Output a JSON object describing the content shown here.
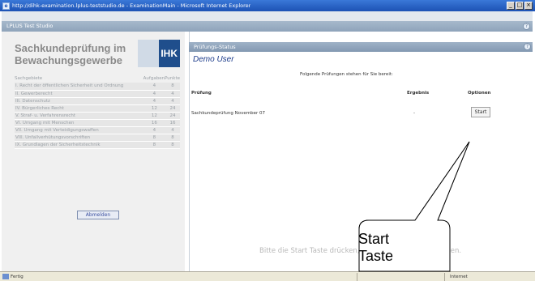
{
  "window": {
    "title": "http://dihk-examination.lplus-teststudio.de - ExaminationMain - Microsoft Internet Explorer",
    "minimize": "_",
    "maximize": "□",
    "close": "×"
  },
  "app": {
    "name": "LPLUS Test Studio",
    "help": "?"
  },
  "left": {
    "title": "Sachkundeprüfung im Bewachungsgewerbe",
    "logo_text": "IHK",
    "table_headers": {
      "subject": "Sachgebiete",
      "tasks": "Aufgaben",
      "points": "Punkte"
    },
    "subjects": [
      {
        "name": "I. Recht der öffentlichen Sicherheit und Ordnung",
        "tasks": "4",
        "points": "8"
      },
      {
        "name": "II. Gewerberecht",
        "tasks": "4",
        "points": "4"
      },
      {
        "name": "III. Datenschutz",
        "tasks": "4",
        "points": "4"
      },
      {
        "name": "IV. Bürgerliches Recht",
        "tasks": "12",
        "points": "24"
      },
      {
        "name": "V. Straf- u. Verfahrensrecht",
        "tasks": "12",
        "points": "24"
      },
      {
        "name": "VI. Umgang mit Menschen",
        "tasks": "16",
        "points": "16"
      },
      {
        "name": "VII. Umgang mit Verteidigungswaffen",
        "tasks": "4",
        "points": "4"
      },
      {
        "name": "VIII. Unfallverhütungsvorschriften",
        "tasks": "8",
        "points": "8"
      },
      {
        "name": "IX. Grundlagen der Sicherheitstechnik",
        "tasks": "8",
        "points": "8"
      }
    ],
    "logout_label": "Abmelden"
  },
  "right": {
    "header": "Prüfungs-Status",
    "help": "?",
    "user": "Demo User",
    "available_note": "Folgende Prüfungen stehen für Sie bereit:",
    "columns": {
      "exam": "Prüfung",
      "result": "Ergebnis",
      "options": "Optionen"
    },
    "exam": {
      "name": "Sachkundeprüfung November 07",
      "result": "-",
      "start_label": "Start"
    },
    "hint": "Bitte die Start Taste drücken, um die Prüfung zu beginnen."
  },
  "status_bar": {
    "ready": "Fertig",
    "zone": "Internet"
  },
  "callout": {
    "line1": "Start",
    "line2": "Taste"
  }
}
